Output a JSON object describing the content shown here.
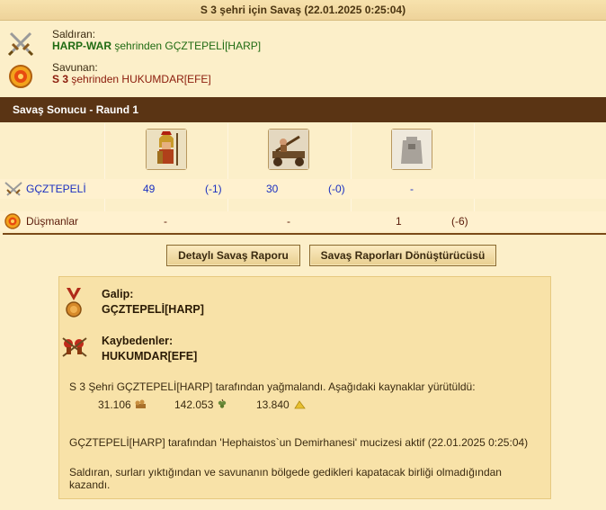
{
  "title": "S 3 şehri için Savaş (22.01.2025 0:25:04)",
  "attacker": {
    "label": "Saldıran:",
    "alliance": "HARP-WAR",
    "mid_text": "şehrinden",
    "player": "GÇZTEPELİ[HARP]"
  },
  "defender": {
    "label": "Savunan:",
    "city": "S 3",
    "mid_text": "şehrinden",
    "player": "HUKUMDAR[EFE]"
  },
  "section_title": "Savaş Sonucu - Raund 1",
  "rows": {
    "attacker": {
      "name": "GÇZTEPELİ",
      "u1": "49",
      "u1_loss": "(-1)",
      "u2": "30",
      "u2_loss": "(-0)",
      "u3": "-"
    },
    "enemies": {
      "name": "Düşmanlar",
      "u1": "-",
      "u2": "-",
      "u3": "1",
      "u3_loss": "(-6)"
    }
  },
  "buttons": {
    "detailed": "Detaylı Savaş Raporu",
    "converter": "Savaş Raporları Dönüştürücüsü"
  },
  "result": {
    "winner_label": "Galip:",
    "winner": "GÇZTEPELİ[HARP]",
    "losers_label": "Kaybedenler:",
    "losers": "HUKUMDAR[EFE]",
    "plunder_text": "S 3 Şehri GÇZTEPELİ[HARP] tarafından yağmalandı. Aşağıdaki kaynaklar yürütüldü:",
    "res_wood": "31.106",
    "res_wine": "142.053",
    "res_sulfur": "13.840",
    "wonder_text": "GÇZTEPELİ[HARP] tarafından 'Hephaistos`un Demirhanesi' mucizesi aktif (22.01.2025 0:25:04)",
    "final_text": "Saldıran, surları yıktığından ve savunanın bölgede gedikleri kapatacak birliği olmadığından kazandı."
  },
  "icons": {
    "attacker": "crossed-swords-icon",
    "defender": "shield-icon",
    "winner": "medal-icon",
    "losers": "fallen-soldiers-icon",
    "wood": "wood-icon",
    "wine": "grapes-icon",
    "sulfur": "sulfur-icon"
  }
}
